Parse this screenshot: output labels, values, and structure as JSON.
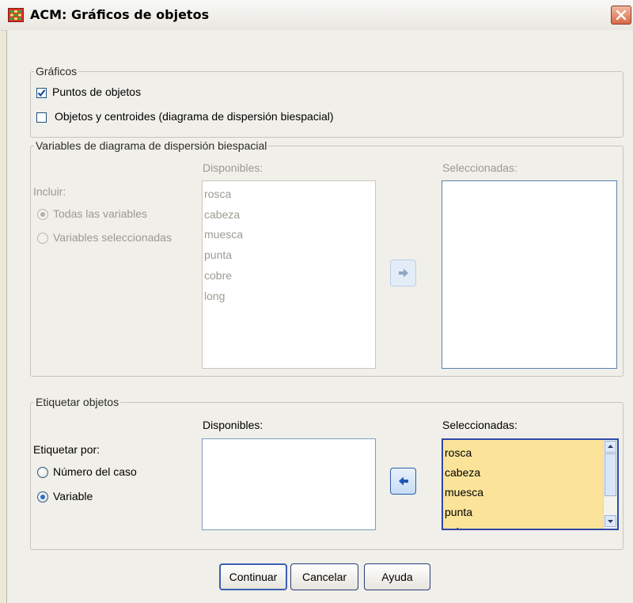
{
  "window": {
    "title": "ACM: Gráficos de objetos"
  },
  "graficos": {
    "legend": "Gráficos",
    "puntos_label": "Puntos de objetos",
    "puntos_checked": true,
    "objetos_label": "Objetos y centroides (diagrama de dispersión biespacial)",
    "objetos_checked": false
  },
  "biplot": {
    "legend": "Variables de diagrama de dispersión biespacial",
    "include_label": "Incluir:",
    "all_vars_label": "Todas las variables",
    "selected_vars_label": "Variables seleccionadas",
    "available_label": "Disponibles:",
    "available": [
      "rosca",
      "cabeza",
      "muesca",
      "punta",
      "cobre",
      "long"
    ],
    "selected_label": "Seleccionadas:",
    "selected": []
  },
  "label_objects": {
    "legend": "Etiquetar objetos",
    "label_by": "Etiquetar por:",
    "case_number_label": "Número del caso",
    "variable_label": "Variable",
    "variable_selected": true,
    "available_label": "Disponibles:",
    "available": [],
    "selected_label": "Seleccionadas:",
    "selected": [
      "rosca",
      "cabeza",
      "muesca",
      "punta",
      "cobre"
    ]
  },
  "buttons": {
    "continue": "Continuar",
    "cancel": "Cancelar",
    "help": "Ayuda"
  },
  "colors": {
    "selected_list_bg": "#fbe49a",
    "selected_list_border": "#3049a6",
    "disabled_text": "#9c9a91"
  }
}
